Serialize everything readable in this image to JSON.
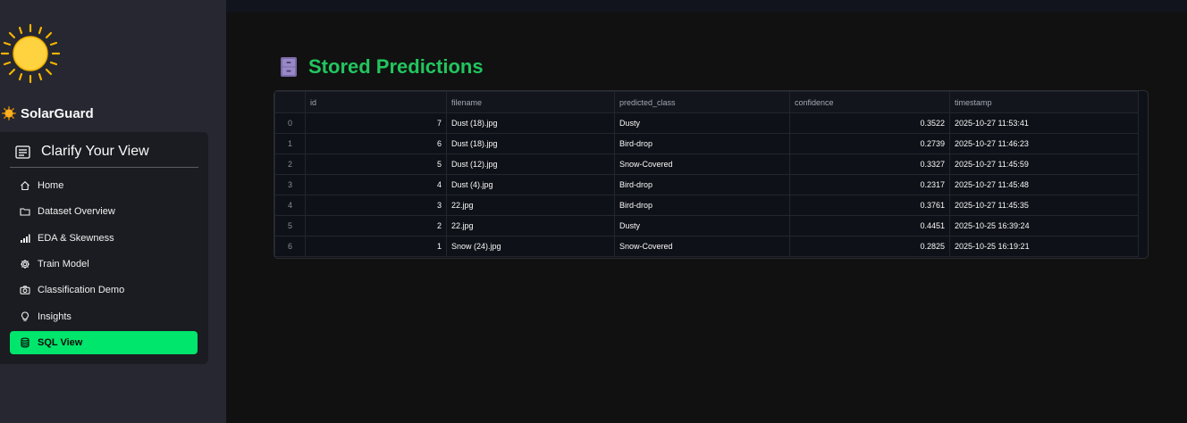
{
  "sidebar": {
    "brand": "SolarGuard",
    "menu_title": "Clarify Your View",
    "items": [
      {
        "label": "Home",
        "icon": "house-icon"
      },
      {
        "label": "Dataset Overview",
        "icon": "folder-icon"
      },
      {
        "label": "EDA & Skewness",
        "icon": "bar-chart-icon"
      },
      {
        "label": "Train Model",
        "icon": "gear-icon"
      },
      {
        "label": "Classification Demo",
        "icon": "camera-icon"
      },
      {
        "label": "Insights",
        "icon": "lightbulb-icon"
      },
      {
        "label": "SQL View",
        "icon": "database-icon",
        "active": true
      }
    ],
    "active_color": "#00e56b"
  },
  "main": {
    "title": "Stored Predictions",
    "title_icon": "file-cabinet-icon",
    "title_color": "#22c55e",
    "table": {
      "columns": [
        "",
        "id",
        "filename",
        "predicted_class",
        "confidence",
        "timestamp"
      ],
      "rows": [
        [
          "0",
          "7",
          "Dust (18).jpg",
          "Dusty",
          "0.3522",
          "2025-10-27 11:53:41"
        ],
        [
          "1",
          "6",
          "Dust (18).jpg",
          "Bird-drop",
          "0.2739",
          "2025-10-27 11:46:23"
        ],
        [
          "2",
          "5",
          "Dust (12).jpg",
          "Snow-Covered",
          "0.3327",
          "2025-10-27 11:45:59"
        ],
        [
          "3",
          "4",
          "Dust (4).jpg",
          "Bird-drop",
          "0.2317",
          "2025-10-27 11:45:48"
        ],
        [
          "4",
          "3",
          "22.jpg",
          "Bird-drop",
          "0.3761",
          "2025-10-27 11:45:35"
        ],
        [
          "5",
          "2",
          "22.jpg",
          "Dusty",
          "0.4451",
          "2025-10-25 16:39:24"
        ],
        [
          "6",
          "1",
          "Snow (24).jpg",
          "Snow-Covered",
          "0.2825",
          "2025-10-25 16:19:21"
        ]
      ]
    }
  }
}
